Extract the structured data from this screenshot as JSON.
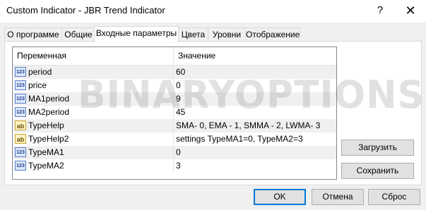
{
  "window": {
    "title": "Custom Indicator - JBR Trend Indicator",
    "help_glyph": "?",
    "close_glyph": "✕"
  },
  "tabs": [
    {
      "label": "О программе",
      "active": false
    },
    {
      "label": "Общие",
      "active": false
    },
    {
      "label": "Входные параметры",
      "active": true
    },
    {
      "label": "Цвета",
      "active": false
    },
    {
      "label": "Уровни",
      "active": false
    },
    {
      "label": "Отображение",
      "active": false
    }
  ],
  "grid": {
    "headers": {
      "name": "Переменная",
      "value": "Значение"
    },
    "rows": [
      {
        "icon": "123",
        "name": "period",
        "value": "60"
      },
      {
        "icon": "123",
        "name": "price",
        "value": "0"
      },
      {
        "icon": "123",
        "name": "MA1period",
        "value": "9"
      },
      {
        "icon": "123",
        "name": "MA2period",
        "value": "45"
      },
      {
        "icon": "ab",
        "name": "TypeHelp",
        "value": "SMA- 0, EMA - 1, SMMA - 2, LWMA- 3"
      },
      {
        "icon": "ab",
        "name": "TypeHelp2",
        "value": "settings TypeMA1=0, TypeMA2=3"
      },
      {
        "icon": "123",
        "name": "TypeMA1",
        "value": "0"
      },
      {
        "icon": "123",
        "name": "TypeMA2",
        "value": "3"
      }
    ]
  },
  "side_buttons": {
    "load": "Загрузить",
    "save": "Сохранить"
  },
  "bottom_buttons": {
    "ok": "OK",
    "cancel": "Отмена",
    "reset": "Сброс"
  },
  "watermark": "BINARYOPTIONSIGNALS.COM"
}
